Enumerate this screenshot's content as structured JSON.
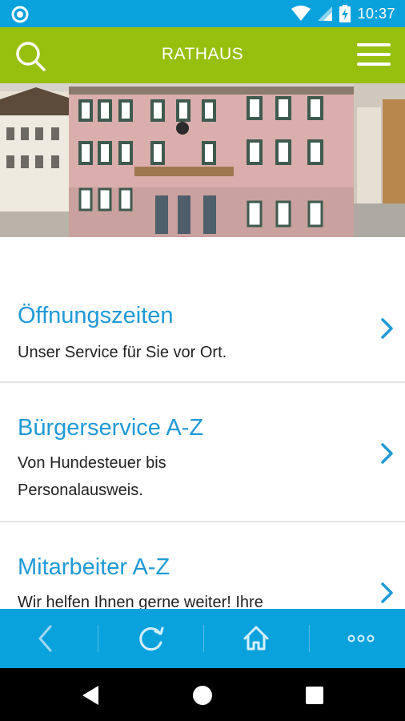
{
  "status_bar": {
    "time": "10:37",
    "icons": [
      "notification-ring-icon",
      "wifi-icon",
      "cell-signal-icon",
      "battery-charging-icon"
    ]
  },
  "app_bar": {
    "title": "RATHAUS",
    "left_icon": "search-icon",
    "right_icon": "hamburger-menu-icon",
    "color": "#97bf0d"
  },
  "hero": {
    "icon": "town-hall-photo"
  },
  "list": {
    "items": [
      {
        "title": "Öffnungszeiten",
        "subtitle_lines": [
          "Unser Service für Sie vor Ort."
        ]
      },
      {
        "title": "Bürgerservice A-Z",
        "subtitle_lines": [
          "Von Hundesteuer bis",
          "Personalausweis."
        ]
      },
      {
        "title": "Mitarbeiter A-Z",
        "subtitle_lines": [
          "Wir helfen Ihnen gerne weiter! Ihre"
        ]
      }
    ],
    "title_color": "#1f9ad6",
    "chevron_color": "#1f9ad6"
  },
  "toolbar": {
    "buttons": [
      "back-icon",
      "reload-icon",
      "home-icon",
      "more-icon"
    ],
    "color": "#0aa2dd"
  },
  "nav_bar": {
    "buttons": [
      "nav-back-icon",
      "nav-home-icon",
      "nav-recents-icon"
    ]
  }
}
